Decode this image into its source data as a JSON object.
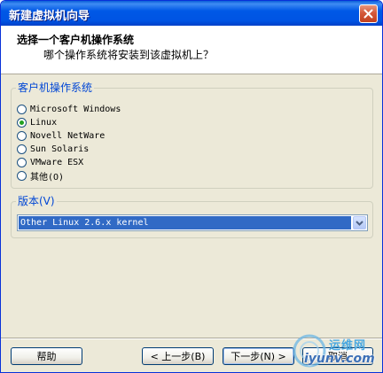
{
  "window": {
    "title": "新建虚拟机向导"
  },
  "header": {
    "title": "选择一个客户机操作系统",
    "subtitle": "哪个操作系统将安装到该虚拟机上？"
  },
  "os_group": {
    "label": "客户机操作系统",
    "options": [
      {
        "label": "Microsoft Windows",
        "checked": false
      },
      {
        "label": "Linux",
        "checked": true
      },
      {
        "label": "Novell NetWare",
        "checked": false
      },
      {
        "label": "Sun Solaris",
        "checked": false
      },
      {
        "label": "VMware ESX",
        "checked": false
      },
      {
        "label": "其他(O)",
        "checked": false
      }
    ]
  },
  "version_group": {
    "label": "版本(V)",
    "selected": "Other Linux 2.6.x kernel"
  },
  "buttons": {
    "help": "帮助",
    "back": "< 上一步(B)",
    "next": "下一步(N) >",
    "cancel": "取消"
  },
  "watermark": {
    "name": "运维网",
    "url": "iyunv.com"
  },
  "colors": {
    "title_bar": "#0054e3",
    "group_label": "#0046d5",
    "selection": "#316ac5",
    "dialog_bg": "#ece9d8"
  }
}
